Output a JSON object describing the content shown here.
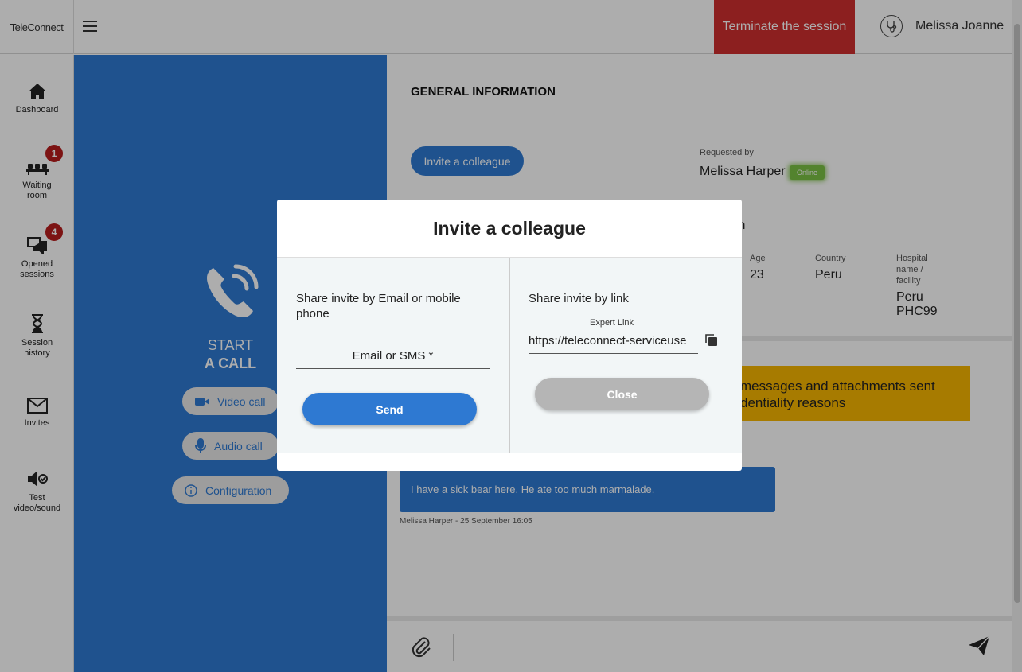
{
  "app": {
    "logo": "TeleConnect"
  },
  "header": {
    "terminate_label": "Terminate the session",
    "user_name": "Melissa Joanne"
  },
  "sidebar": {
    "items": [
      {
        "label": "Dashboard",
        "icon": "home-icon"
      },
      {
        "label": "Waiting room",
        "icon": "waiting-room-icon",
        "badge": "1"
      },
      {
        "label": "Opened sessions",
        "icon": "chat-icon",
        "badge": "4"
      },
      {
        "label": "Session history",
        "icon": "hourglass-icon"
      },
      {
        "label": "Invites",
        "icon": "envelope-icon"
      },
      {
        "label": "Test video/sound",
        "icon": "speaker-check-icon"
      }
    ]
  },
  "call_panel": {
    "start": "START",
    "a_call": "A CALL",
    "video_call": "Video call",
    "audio_call": "Audio call",
    "configuration": "Configuration"
  },
  "main": {
    "section_title": "GENERAL INFORMATION",
    "invite_button": "Invite a colleague",
    "requested_by_label": "Requested by",
    "requested_by_value": "Melissa Harper",
    "online_badge": "Online",
    "partial_text": "in",
    "age_label": "Age",
    "age_value": "23",
    "country_label": "Country",
    "country_value": "Peru",
    "hospital_label": "Hospital name / facility",
    "hospital_value": "Peru PHC99",
    "notice_text": "messages and attachments sent dentiality reasons",
    "message_text": "I have a sick bear here. He ate too much marmalade.",
    "message_meta": "Melissa Harper - 25 September 16:05"
  },
  "modal": {
    "title": "Invite a colleague",
    "left_heading": "Share invite by Email or mobile phone",
    "email_field_label": "Email or SMS *",
    "send_label": "Send",
    "right_heading": "Share invite by link",
    "expert_link_label": "Expert Link",
    "expert_link_value": "https://teleconnect-serviceuse",
    "close_label": "Close"
  },
  "colors": {
    "primary": "#2e79d2",
    "danger": "#cf2e2e",
    "online": "#7bc144",
    "notice": "#f7b500"
  }
}
